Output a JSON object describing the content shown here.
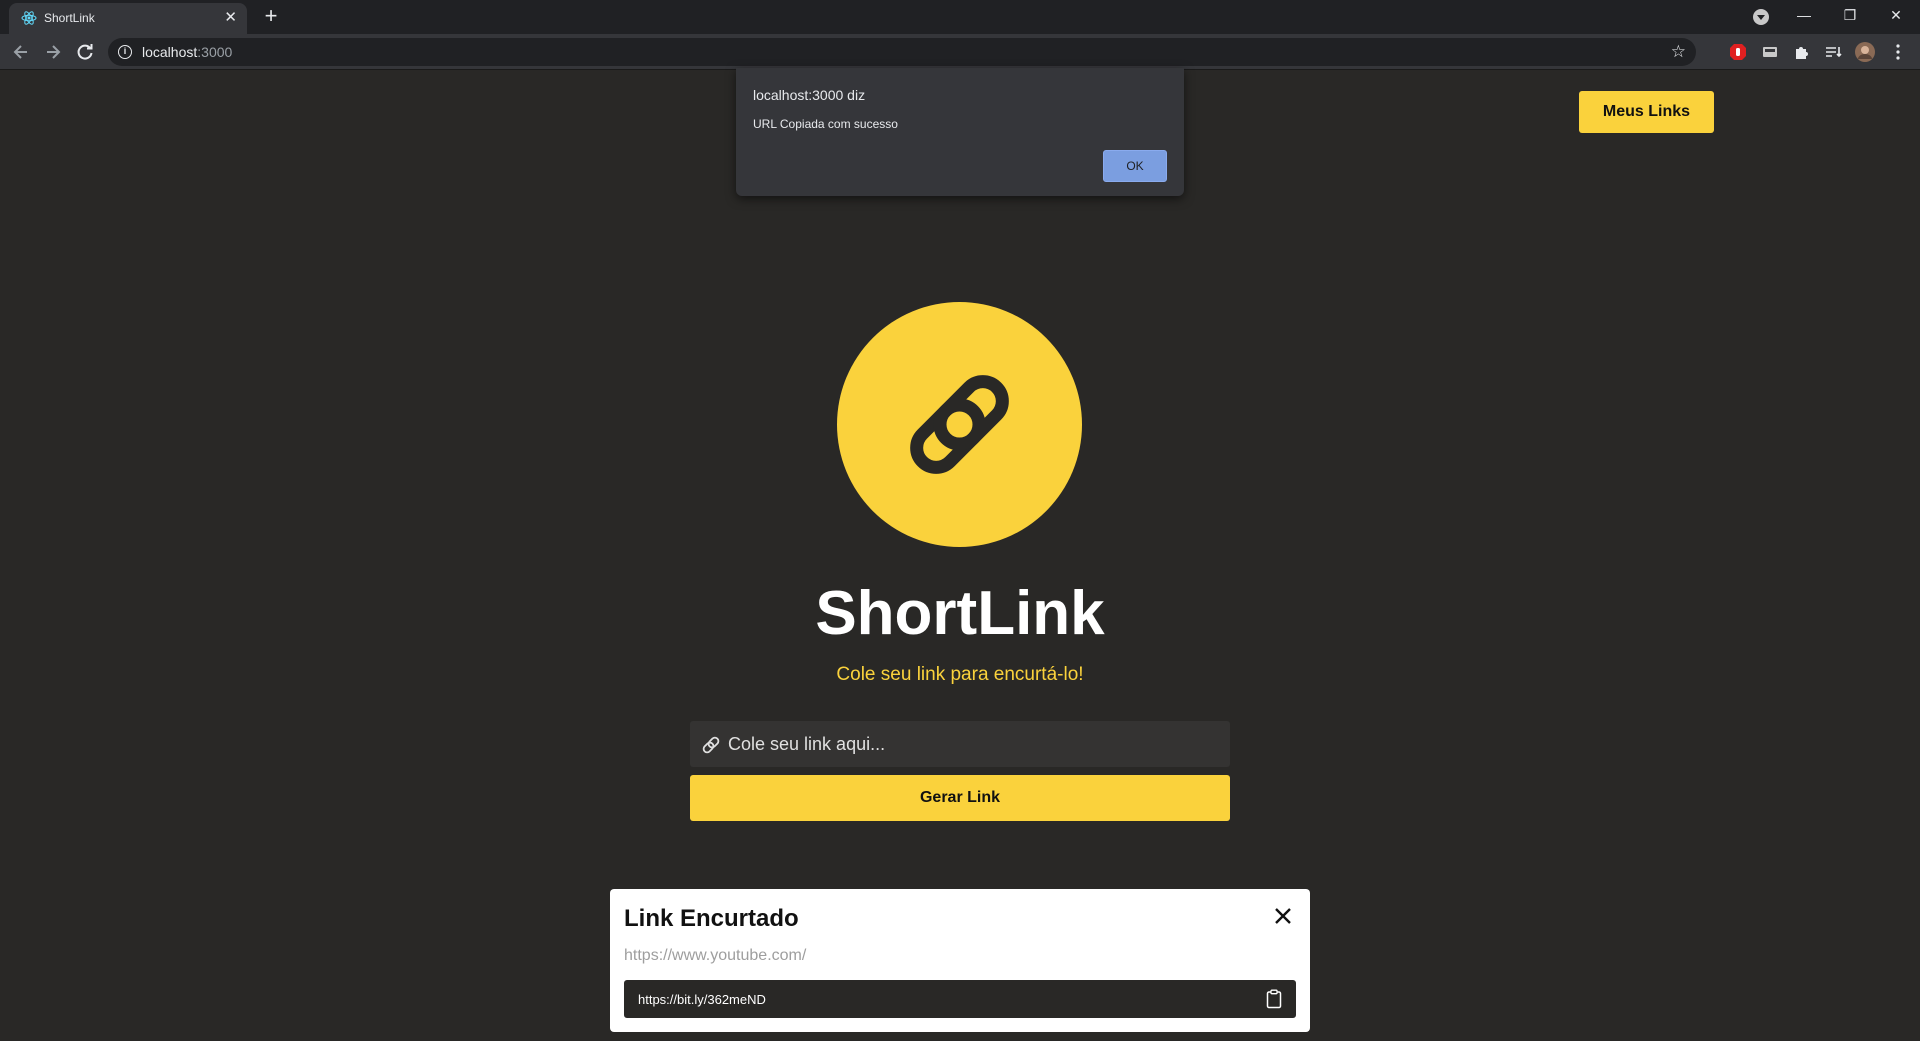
{
  "browser": {
    "tab_title": "ShortLink",
    "tab_close": "✕",
    "new_tab": "+",
    "url_host": "localhost",
    "url_port": ":3000",
    "minimize": "—",
    "restore": "❐",
    "close": "✕"
  },
  "page": {
    "my_links_label": "Meus Links",
    "title": "ShortLink",
    "subtitle": "Cole seu link para encurtá-lo!",
    "input_placeholder": "Cole seu link aqui...",
    "generate_label": "Gerar Link",
    "accent_color": "#fad23c",
    "background_color": "#292826"
  },
  "result": {
    "title": "Link Encurtado",
    "original_url": "https://www.youtube.com/",
    "short_url": "https://bit.ly/362meND"
  },
  "alert": {
    "title": "localhost:3000 diz",
    "message": "URL Copiada com sucesso",
    "ok_label": "OK"
  }
}
